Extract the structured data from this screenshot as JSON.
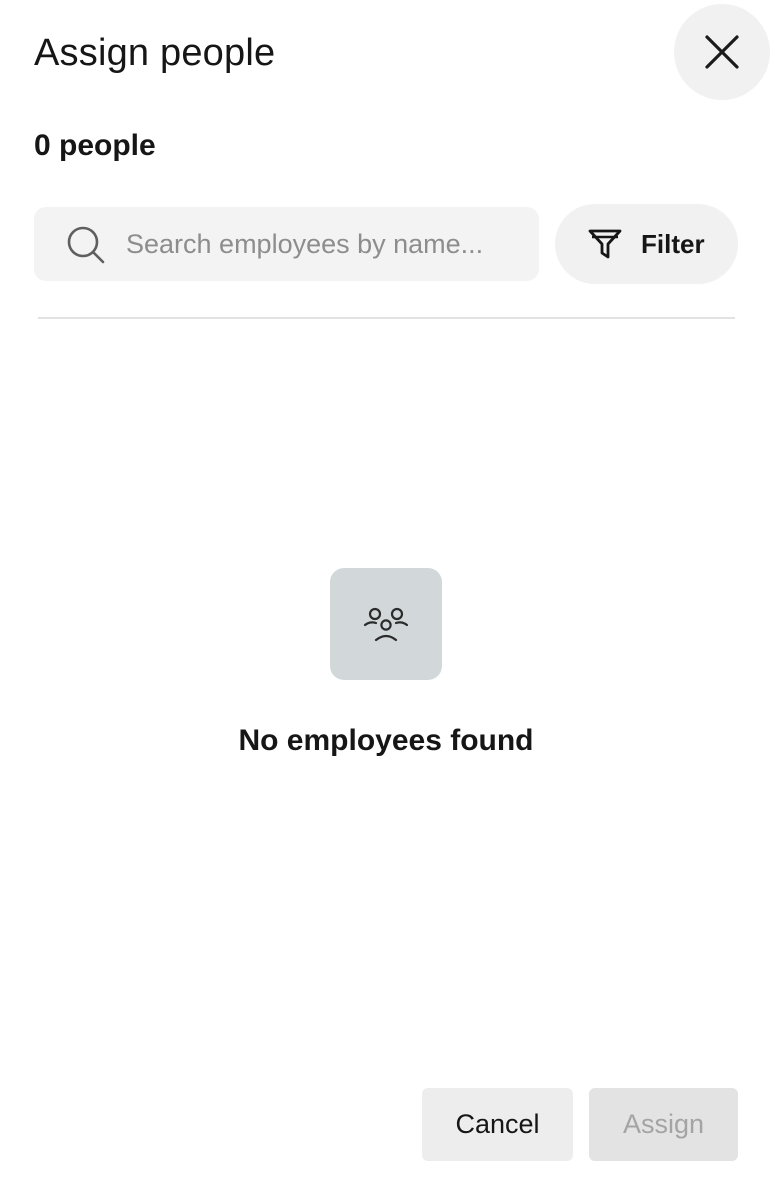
{
  "dialog": {
    "title": "Assign people",
    "close_icon": "close-icon"
  },
  "selection": {
    "count_text": "0 people"
  },
  "search": {
    "placeholder": "Search employees by name...",
    "value": "",
    "icon": "search-icon"
  },
  "filter": {
    "label": "Filter",
    "icon": "funnel-icon"
  },
  "empty_state": {
    "icon": "people-sad-icon",
    "message": "No employees found"
  },
  "footer": {
    "cancel_label": "Cancel",
    "assign_label": "Assign"
  },
  "colors": {
    "panel_bg": "#ffffff",
    "input_bg": "#f3f3f3",
    "empty_icon_bg": "#d2d8da",
    "disabled_text": "#a4a4a4"
  }
}
